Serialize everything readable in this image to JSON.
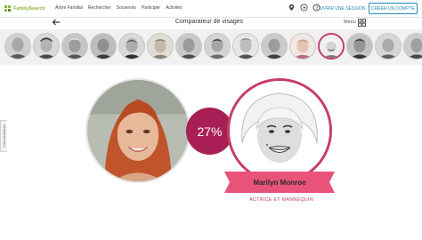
{
  "header": {
    "logo_text": "FamilySearch",
    "nav": [
      "Arbre Familial",
      "Rechercher",
      "Souvenirs",
      "Participer",
      "Activités"
    ],
    "signin_label": "OUVRIR UNE SESSION",
    "create_label": "CRÉER UN COMPTE"
  },
  "toolbar": {
    "title": "Comparateur de visages",
    "menu_label": "Menu"
  },
  "feedback_label": "Commentaires",
  "comparison": {
    "score": "27%",
    "match_name": "Marilyn Monroe",
    "match_occupation": "ACTRICE ET MANNEQUIN"
  },
  "colors": {
    "brand_green": "#8cb83c",
    "accent": "#c43d6a",
    "score_bg": "#a81f55",
    "link_blue": "#1f8bb0"
  }
}
